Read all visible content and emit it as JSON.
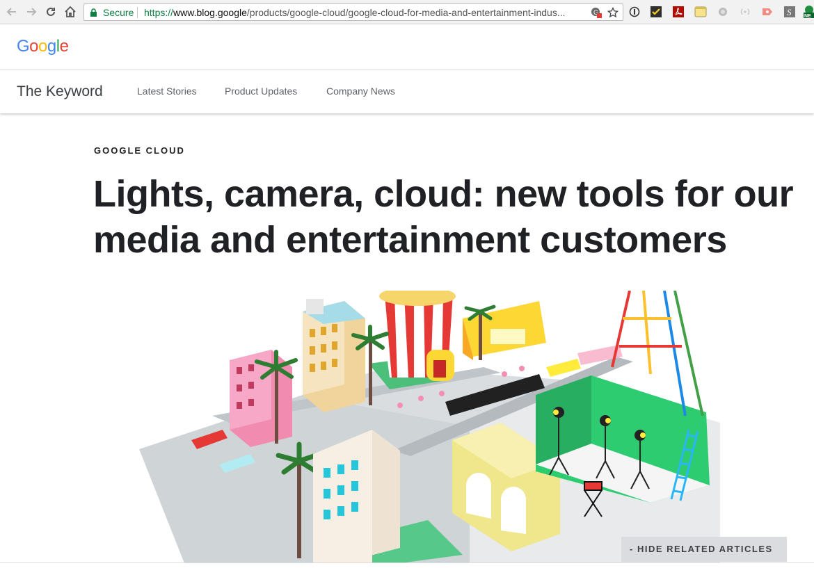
{
  "browser": {
    "security_label": "Secure",
    "url_scheme": "https://",
    "url_host": "www.blog.google",
    "url_path": "/products/google-cloud/google-cloud-for-media-and-entertainment-indus..."
  },
  "site": {
    "logo_letters": [
      "G",
      "o",
      "o",
      "g",
      "l",
      "e"
    ],
    "logo_colors": [
      "#4285F4",
      "#EA4335",
      "#FBBC05",
      "#4285F4",
      "#34A853",
      "#EA4335"
    ],
    "blog_name": "The Keyword",
    "nav": [
      "Latest Stories",
      "Product Updates",
      "Company News"
    ]
  },
  "article": {
    "category": "GOOGLE CLOUD",
    "title": "Lights, camera, cloud: new tools for our media and entertainment customers",
    "hero_icon": "paper-craft-city-illustration"
  },
  "related": {
    "toggle_label": "- HIDE RELATED ARTICLES"
  },
  "colors": {
    "secure_green": "#0b8043",
    "text_dark": "#202124",
    "nav_gray": "#5f6368",
    "button_bg": "#dadce0"
  }
}
